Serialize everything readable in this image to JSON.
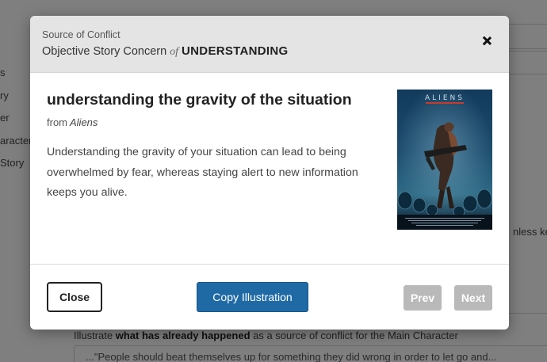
{
  "background": {
    "sidebar_items": [
      "s",
      "ry",
      "er",
      "aracter",
      "Story"
    ],
    "side_text": "nless ke",
    "prompt_prefix": "Illustrate ",
    "prompt_bold": "what has already happened",
    "prompt_suffix": " as a source of conflict for the Main Character",
    "textarea_text": "...\"People should beat themselves up for something they did wrong in order to let go and..."
  },
  "modal": {
    "subtitle": "Source of Conflict",
    "title_prefix": "Objective Story Concern",
    "title_of": "of",
    "concern": "UNDERSTANDING",
    "illustration_title": "understanding the gravity of the situation",
    "from_label": "from",
    "story_title": "Aliens",
    "description": "Understanding the gravity of your situation can lead to being overwhelmed by fear, whereas staying alert to new information keeps you alive.",
    "poster_title": "ALIENS",
    "buttons": {
      "close": "Close",
      "copy": "Copy Illustration",
      "prev": "Prev",
      "next": "Next"
    }
  },
  "colors": {
    "primary": "#1f6aa5",
    "disabled": "#b9b9b9",
    "header_bg": "#e4e4e4"
  }
}
